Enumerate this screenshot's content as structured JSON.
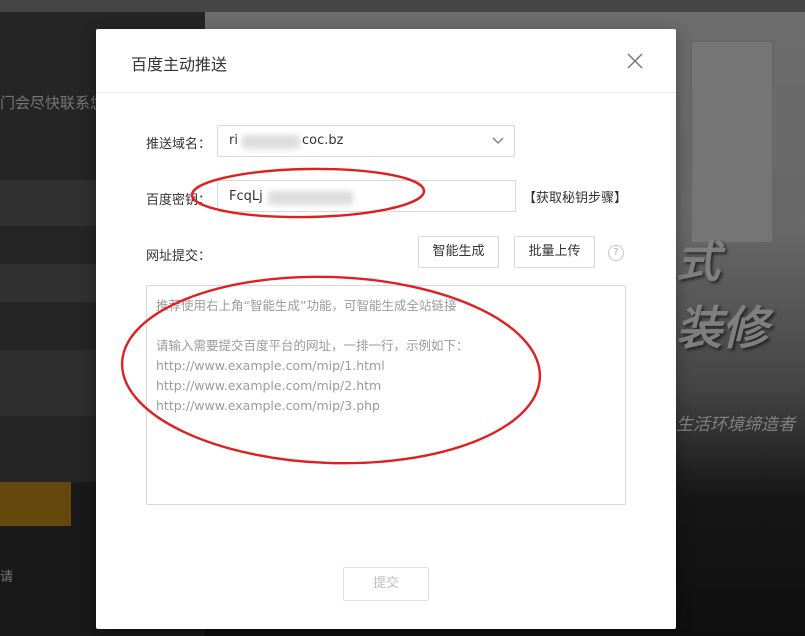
{
  "background": {
    "left_text": "门会尽快联系您",
    "bottom_text": "请",
    "headline_line1": "式",
    "headline_line2": "装修",
    "slogan": "生活环境缔造者"
  },
  "modal": {
    "title": "百度主动推送",
    "domain_label": "推送域名：",
    "domain_prefix": "ri",
    "domain_suffix": "coc.bz",
    "key_label": "百度密钥：",
    "key_prefix": "FcqLj",
    "get_key_link": "【获取秘钥步骤】",
    "url_label": "网址提交：",
    "generate_button": "智能生成",
    "batch_upload_button": "批量上传",
    "help_symbol": "?",
    "textarea_placeholder": "推荐使用右上角“智能生成”功能，可智能生成全站链接\n\n请输入需要提交百度平台的网址，一排一行，示例如下：\nhttp://www.example.com/mip/1.html\nhttp://www.example.com/mip/2.htm\nhttp://www.example.com/mip/3.php",
    "submit_button": "提交"
  },
  "colors": {
    "annotation_red": "#e02020",
    "accent_orange": "#c9901a"
  }
}
